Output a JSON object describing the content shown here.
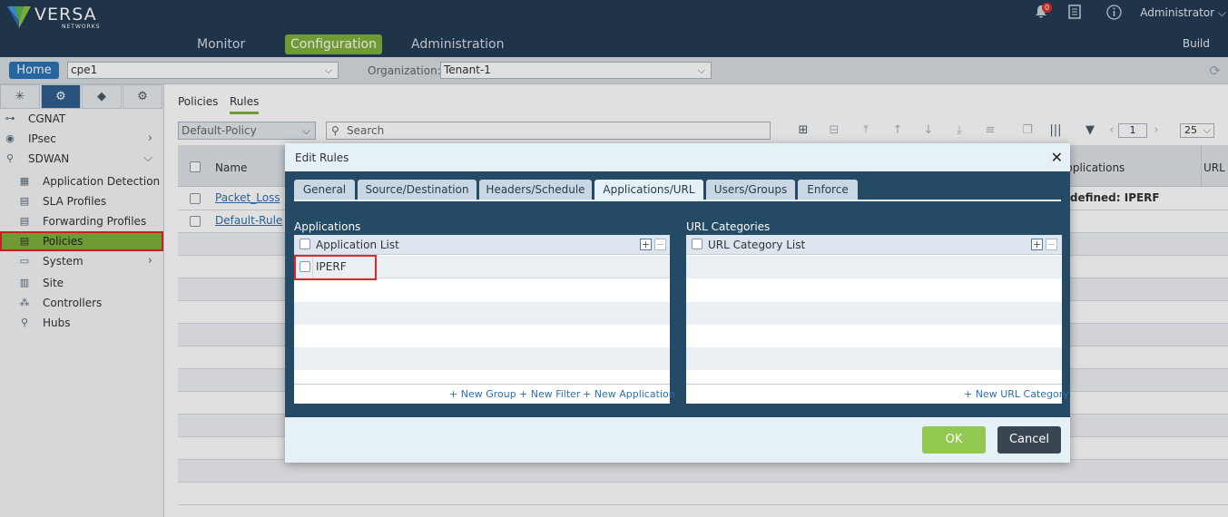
{
  "app": {
    "logo_text": "VERSA",
    "logo_subtext": "NETWORKS",
    "notification_count": "0",
    "user": "Administrator",
    "build_label": "Build"
  },
  "nav": {
    "items": [
      {
        "label": "Monitor"
      },
      {
        "label": "Configuration"
      },
      {
        "label": "Administration"
      }
    ],
    "active": "Configuration"
  },
  "subbar": {
    "home_label": "Home",
    "device_value": "cpe1",
    "org_label": "Organization:",
    "org_value": "Tenant-1"
  },
  "sidebar": {
    "items": [
      {
        "label": "CGNAT",
        "icon": "nat-icon"
      },
      {
        "label": "IPsec",
        "icon": "ipsec-icon"
      },
      {
        "label": "SDWAN",
        "icon": "sdwan-icon"
      },
      {
        "label": "Application Detection",
        "icon": "app-detection-icon"
      },
      {
        "label": "SLA Profiles",
        "icon": "sla-icon"
      },
      {
        "label": "Forwarding Profiles",
        "icon": "forwarding-icon"
      },
      {
        "label": "Policies",
        "icon": "policies-icon"
      },
      {
        "label": "System",
        "icon": "system-icon"
      },
      {
        "label": "Site",
        "icon": "site-icon"
      },
      {
        "label": "Controllers",
        "icon": "controllers-icon"
      },
      {
        "label": "Hubs",
        "icon": "hubs-icon"
      }
    ],
    "selected": "Policies"
  },
  "main": {
    "tabs": [
      {
        "label": "Policies"
      },
      {
        "label": "Rules"
      }
    ],
    "active_tab": "Rules",
    "policy_select": "Default-Policy",
    "search_placeholder": "Search",
    "page_number": "1",
    "page_size": "25",
    "columns": {
      "name": "Name",
      "applications": "Applications",
      "url": "URL"
    },
    "rows": [
      {
        "name": "Packet_Loss",
        "applications": "Predefined: IPERF"
      },
      {
        "name": "Default-Rule",
        "applications": ""
      }
    ]
  },
  "modal": {
    "title": "Edit Rules",
    "tabs": [
      {
        "label": "General"
      },
      {
        "label": "Source/Destination"
      },
      {
        "label": "Headers/Schedule"
      },
      {
        "label": "Applications/URL"
      },
      {
        "label": "Users/Groups"
      },
      {
        "label": "Enforce"
      }
    ],
    "active_tab": "Applications/URL",
    "applications": {
      "section_label": "Applications",
      "list_header": "Application List",
      "items": [
        "IPERF"
      ],
      "links": {
        "new_group": "+ New Group",
        "new_filter": "+ New Filter",
        "new_application": "+ New Application"
      }
    },
    "url_categories": {
      "section_label": "URL Categories",
      "list_header": "URL Category List",
      "links": {
        "new_url_category": "+ New URL Category"
      }
    },
    "ok_label": "OK",
    "cancel_label": "Cancel"
  },
  "colors": {
    "topbar": "#243c54",
    "accent_green": "#7fb03c",
    "modal_body": "#244a66",
    "highlight_red": "#e0262b",
    "home_blue": "#2d74b8"
  }
}
